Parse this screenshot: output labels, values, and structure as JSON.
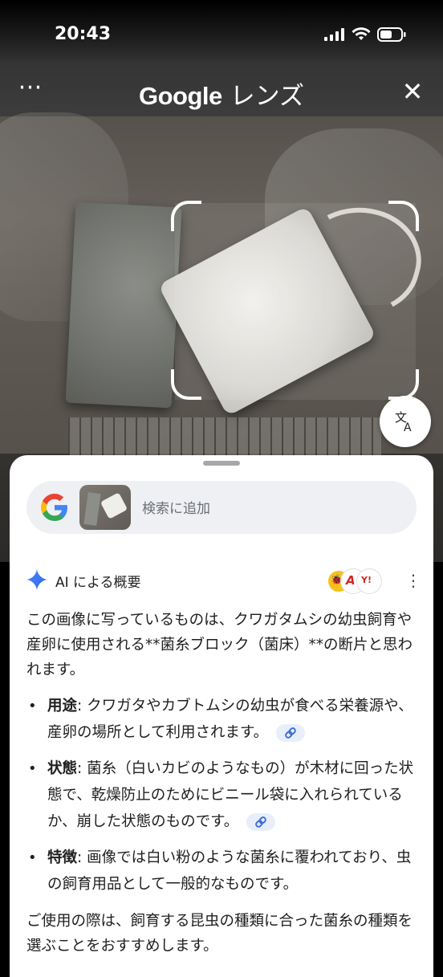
{
  "status_bar": {
    "time": "20:43"
  },
  "header": {
    "title_brand": "Google",
    "title_suffix": " レンズ",
    "more_label": "⋯",
    "close_label": "✕"
  },
  "search": {
    "placeholder": "検索に追加"
  },
  "ai_overview": {
    "title": "AI による概要",
    "source_icons": [
      "source-icon-1",
      "source-icon-2",
      "source-icon-3"
    ],
    "intro": "この画像に写っているものは、クワガタムシの幼虫飼育や産卵に使用される**菌糸ブロック（菌床）**の断片と思われます。",
    "bullets": [
      {
        "term": "用途",
        "text": ": クワガタやカブトムシの幼虫が食べる栄養源や、産卵の場所として利用されます。",
        "has_link": true
      },
      {
        "term": "状態",
        "text": ": 菌糸（白いカビのようなもの）が木材に回った状態で、乾燥防止のためにビニール袋に入れられているか、崩した状態のものです。",
        "has_link": true
      },
      {
        "term": "特徴",
        "text": ": 画像では白い粉のような菌糸に覆われており、虫の飼育用品として一般的なものです。",
        "has_link": false
      }
    ],
    "closing": "ご使用の際は、飼育する昆虫の種類に合った菌糸の種類を選ぶことをおすすめします。"
  },
  "colors": {
    "accent_blue": "#4285F4",
    "chip_bg": "#e9eefb",
    "search_bg": "#eef0f3"
  }
}
